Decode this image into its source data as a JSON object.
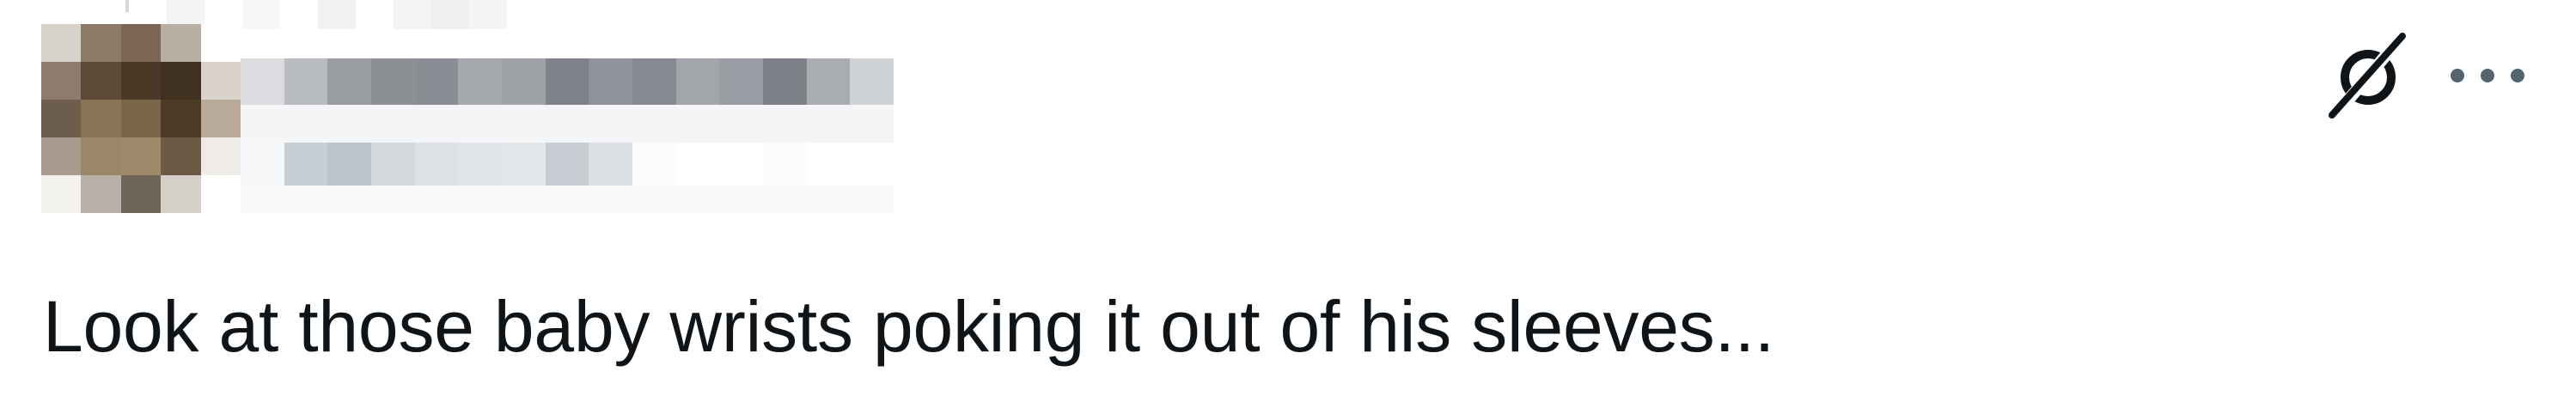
{
  "post": {
    "author": {
      "display_name": "",
      "handle": "",
      "avatar_redacted": true
    },
    "text": "Look at those baby wrists poking it out of his sleeves..."
  },
  "actions": {
    "grok_icon": "grok-icon",
    "more_icon": "more-horizontal-icon"
  },
  "colors": {
    "text_primary": "#0f1419",
    "icon": "#536471",
    "thread_line": "#cfd9de",
    "background": "#ffffff"
  }
}
